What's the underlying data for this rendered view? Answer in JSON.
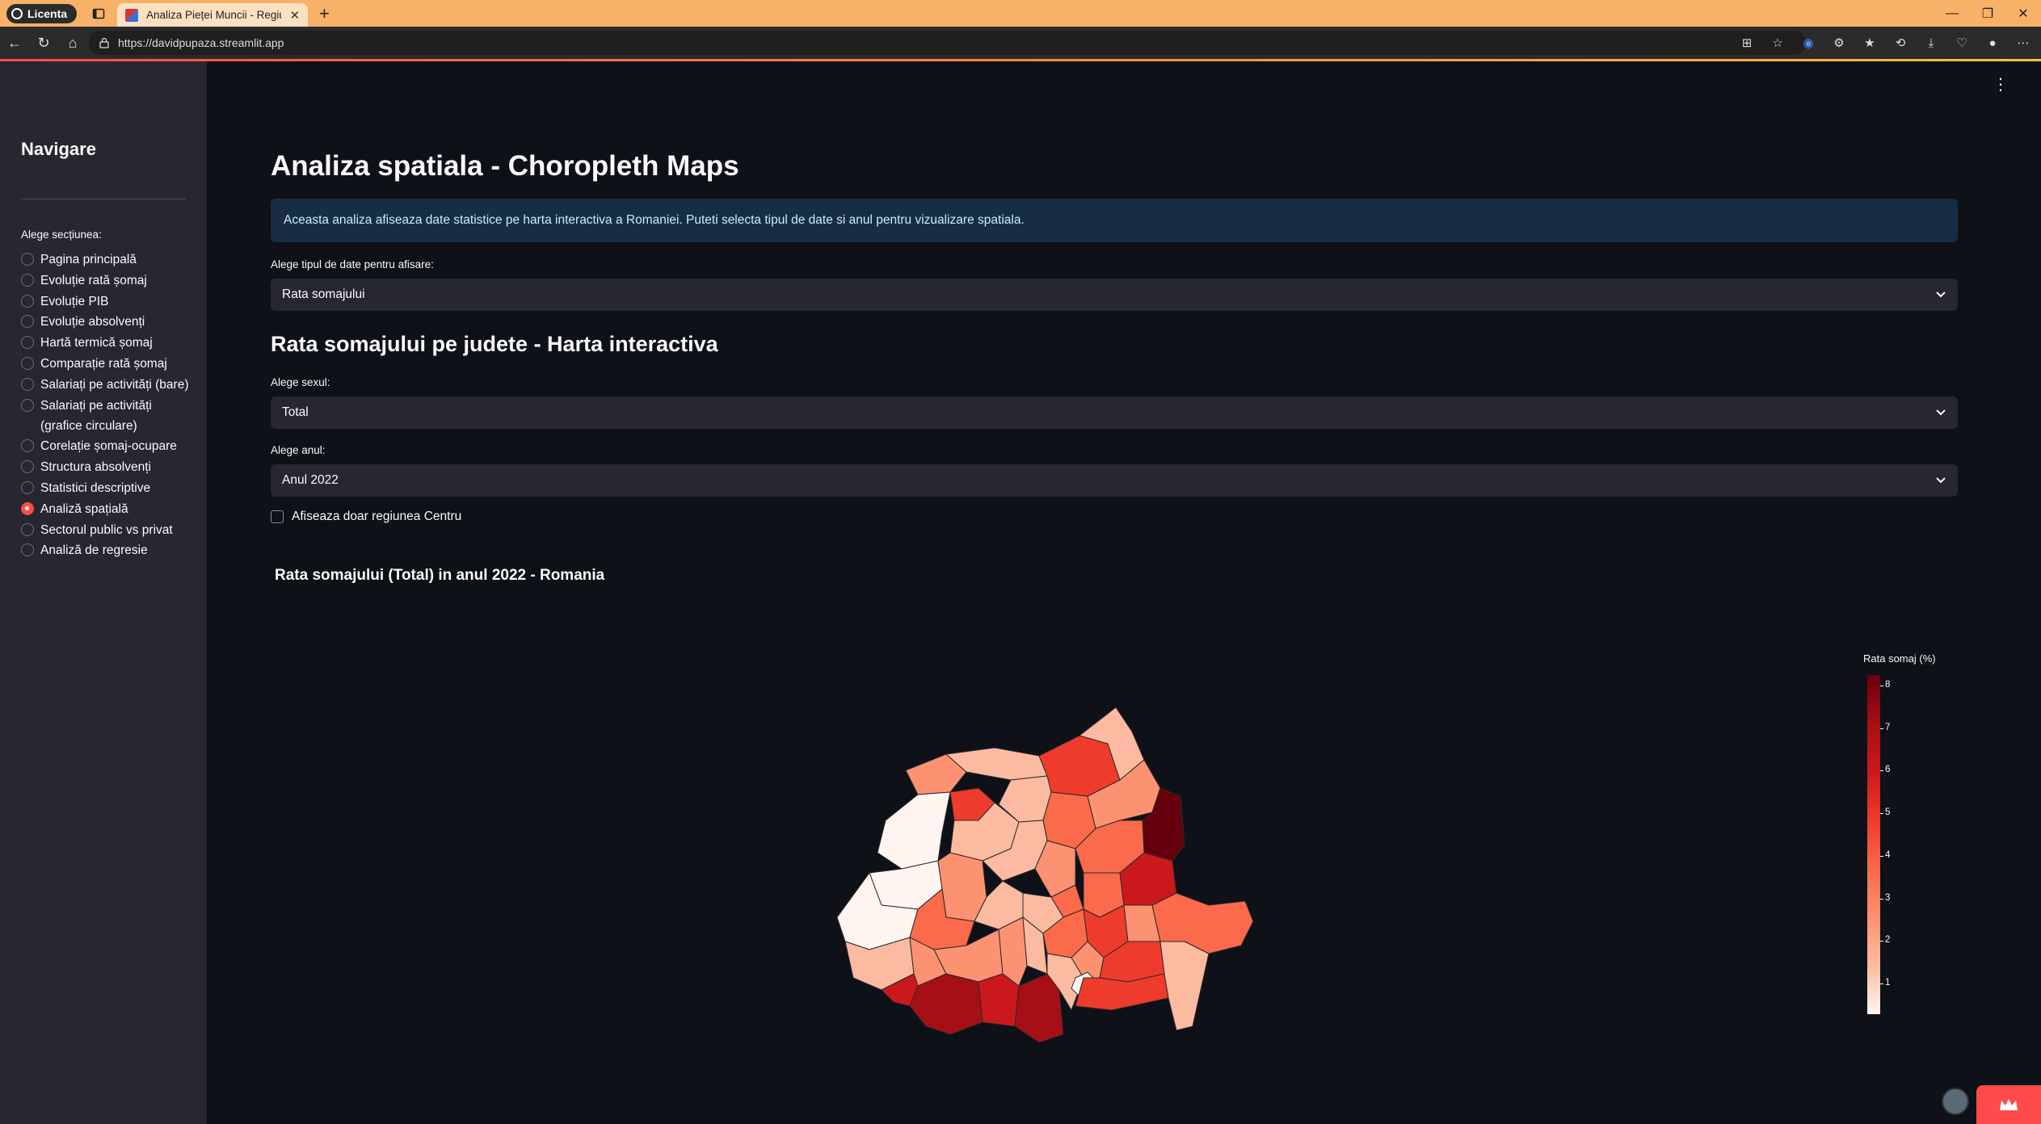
{
  "browser": {
    "profile_label": "Licenta",
    "tab_title": "Analiza Pieței Muncii - Regiunea C",
    "url": "https://davidpupaza.streamlit.app"
  },
  "sidebar": {
    "title": "Navigare",
    "section_label": "Alege secțiunea:",
    "items": [
      {
        "label": "Pagina principală",
        "selected": false
      },
      {
        "label": "Evoluție rată șomaj",
        "selected": false
      },
      {
        "label": "Evoluție PIB",
        "selected": false
      },
      {
        "label": "Evoluție absolvenți",
        "selected": false
      },
      {
        "label": "Hartă termică șomaj",
        "selected": false
      },
      {
        "label": "Comparație rată șomaj",
        "selected": false
      },
      {
        "label": "Salariați pe activități (bare)",
        "selected": false
      },
      {
        "label": "Salariați pe activități (grafice circulare)",
        "selected": false
      },
      {
        "label": "Corelație șomaj-ocupare",
        "selected": false
      },
      {
        "label": "Structura absolvenți",
        "selected": false
      },
      {
        "label": "Statistici descriptive",
        "selected": false
      },
      {
        "label": "Analiză spațială",
        "selected": true
      },
      {
        "label": "Sectorul public vs privat",
        "selected": false
      },
      {
        "label": "Analiză de regresie",
        "selected": false
      }
    ]
  },
  "main": {
    "title": "Analiza spatiala - Choropleth Maps",
    "info": "Aceasta analiza afiseaza date statistice pe harta interactiva a Romaniei. Puteti selecta tipul de date si anul pentru vizualizare spatiala.",
    "data_type_label": "Alege tipul de date pentru afisare:",
    "data_type_value": "Rata somajului",
    "subheader": "Rata somajului pe judete - Harta interactiva",
    "sex_label": "Alege sexul:",
    "sex_value": "Total",
    "year_label": "Alege anul:",
    "year_value": "Anul 2022",
    "checkbox_label": "Afiseaza doar regiunea Centru",
    "checkbox_checked": false
  },
  "map": {
    "title": "Rata somajului (Total) in anul 2022 - Romania",
    "colorbar_title": "Rata somaj (%)",
    "colorbar_ticks": [
      "8",
      "7",
      "6",
      "5",
      "4",
      "3",
      "2",
      "1"
    ],
    "colorscale": [
      "#fff5f0",
      "#fcbba1",
      "#fc9272",
      "#fb6a4a",
      "#ef3b2c",
      "#cb181d",
      "#a50f15",
      "#67000d"
    ]
  },
  "colors": {
    "app_bg": "#0e1117",
    "sidebar_bg": "#262730",
    "accent": "#ff4b4b",
    "info_bg": "#172d43",
    "tabbar_bg": "#f7b267"
  }
}
